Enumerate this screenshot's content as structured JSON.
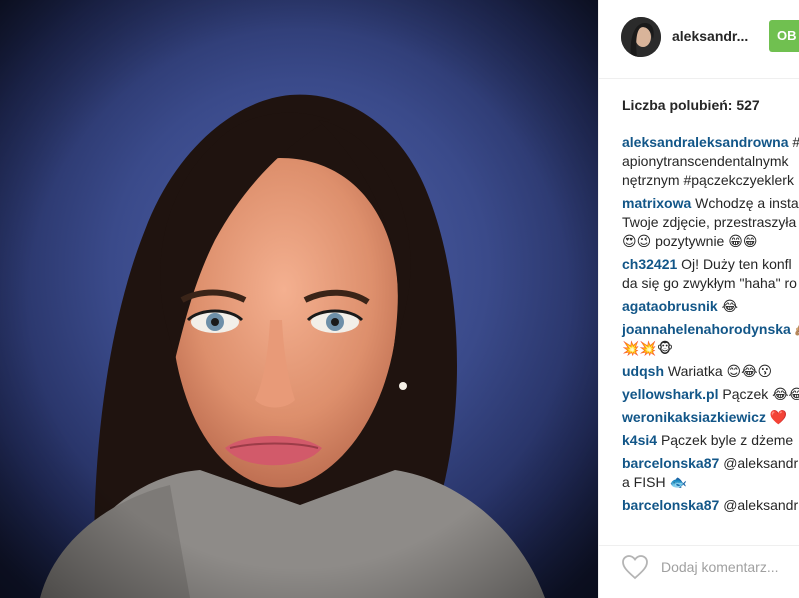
{
  "post": {
    "username": "aleksandr...",
    "follow_label": "OB",
    "likes": "Liczba polubień: 527",
    "add_comment_placeholder": "Dodaj komentarz..."
  },
  "comments": [
    {
      "user": "aleksandraleksandrowna",
      "lines": [
        "#",
        "apionytranscendentalnymk",
        "nętrznym #pączekczyeklerk"
      ]
    },
    {
      "user": "matrixowa",
      "lines": [
        "Wchodzę a insta",
        "Twoje zdjęcie, przestraszyła",
        "😍😉 pozytywnie 😁😁"
      ]
    },
    {
      "user": "ch32421",
      "lines": [
        "Oj! Duży ten konfl",
        "da się go zwykłym \"haha\" ro"
      ]
    },
    {
      "user": "agataobrusnik",
      "lines": [
        "😂"
      ]
    },
    {
      "user": "joannahelenahorodynska",
      "lines": [
        "🙈",
        "💥💥🐵"
      ]
    },
    {
      "user": "udqsh",
      "lines": [
        "Wariatka 😊😂😗"
      ]
    },
    {
      "user": "yellowshark.pl",
      "lines": [
        "Pączek 😂😂"
      ]
    },
    {
      "user": "weronikaksiazkiewicz",
      "lines": [
        "❤️"
      ]
    },
    {
      "user": "k4si4",
      "lines": [
        "Pączek byle z dżeme"
      ]
    },
    {
      "user": "barcelonska87",
      "lines": [
        "@aleksandr",
        "a FISH 🐟"
      ]
    },
    {
      "user": "barcelonska87",
      "lines": [
        "@aleksandr"
      ]
    }
  ],
  "icons": {
    "heart": "heart-outline-icon"
  },
  "colors": {
    "username_link": "#125688",
    "follow_button": "#70c050",
    "text": "#262626",
    "placeholder": "#a0a0a0"
  }
}
